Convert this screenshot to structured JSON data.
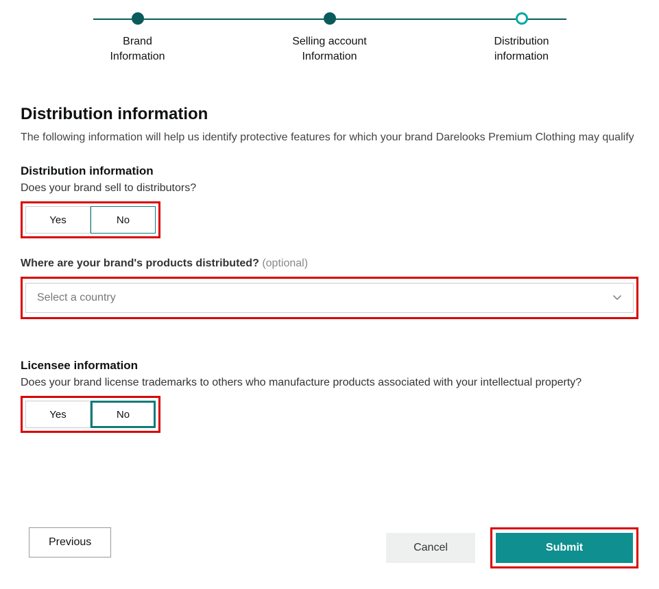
{
  "stepper": {
    "steps": [
      {
        "label_line1": "Brand",
        "label_line2": "Information"
      },
      {
        "label_line1": "Selling account",
        "label_line2": "Information"
      },
      {
        "label_line1": "Distribution",
        "label_line2": "information"
      }
    ]
  },
  "page": {
    "title": "Distribution information",
    "description": "The following information will help us identify protective features for which your brand Darelooks Premium Clothing may qualify"
  },
  "distribution": {
    "heading": "Distribution information",
    "question1": "Does your brand sell to distributors?",
    "yes": "Yes",
    "no": "No",
    "question2_label": "Where are your brand's products distributed?",
    "question2_optional": "(optional)",
    "select_placeholder": "Select a country"
  },
  "licensee": {
    "heading": "Licensee information",
    "question": "Does your brand license trademarks to others who manufacture products associated with your intellectual property?",
    "yes": "Yes",
    "no": "No"
  },
  "actions": {
    "previous": "Previous",
    "cancel": "Cancel",
    "submit": "Submit"
  }
}
